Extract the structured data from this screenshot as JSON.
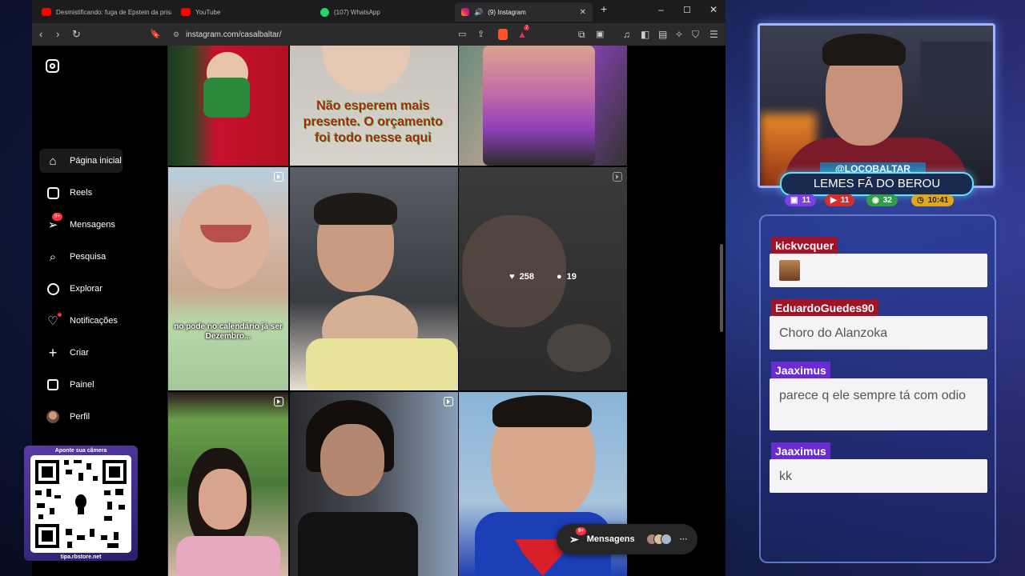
{
  "browser": {
    "tabs": [
      {
        "label": "Desmistificando: fuga de Epstein da prisão e"
      },
      {
        "label": "YouTube"
      },
      {
        "label": "(107) WhatsApp"
      },
      {
        "label": "(9) Instagram"
      }
    ],
    "url": "instagram.com/casalbaltar/",
    "extension_badge": "7"
  },
  "instagram": {
    "nav": [
      {
        "label": "Página inicial",
        "icon": "home-icon"
      },
      {
        "label": "Reels",
        "icon": "reels-icon"
      },
      {
        "label": "Mensagens",
        "icon": "messages-icon",
        "badge": "9+"
      },
      {
        "label": "Pesquisa",
        "icon": "search-icon"
      },
      {
        "label": "Explorar",
        "icon": "explore-icon"
      },
      {
        "label": "Notificações",
        "icon": "heart-icon"
      },
      {
        "label": "Criar",
        "icon": "plus-icon"
      },
      {
        "label": "Painel",
        "icon": "dashboard-icon"
      },
      {
        "label": "Perfil",
        "icon": "avatar"
      }
    ],
    "posts": {
      "post2_text": "Não esperem mais presente. O orçamento foi todo nesse aqui",
      "post4_text": "no pode no calendário já ser Dezembro...",
      "post6_likes": "258",
      "post6_comments": "19"
    },
    "messages_pill": {
      "label": "Mensagens",
      "badge": "9+"
    }
  },
  "qr_card": {
    "caption": "Aponte sua câmera",
    "footer": "tipa.rbstore.net"
  },
  "overlay": {
    "streamer_handle": "@LOCOBALTAR",
    "stream_title": "LEMES FÃ DO BEROU",
    "stats": [
      {
        "icon": "twitch-icon",
        "value": "11",
        "color": "#7b3fe4"
      },
      {
        "icon": "youtube-icon",
        "value": "11",
        "color": "#d23030"
      },
      {
        "icon": "kick-icon",
        "value": "32",
        "color": "#2f9d4a"
      },
      {
        "icon": "clock-icon",
        "value": "10:41",
        "color": "#e0a71a"
      }
    ],
    "chat": [
      {
        "user": "kickvcquer",
        "message": "",
        "emote": true,
        "user_color": "#a0142a"
      },
      {
        "user": "EduardoGuedes90",
        "message": "Choro do Alanzoka",
        "user_color": "#a0142a"
      },
      {
        "user": "Jaaximus",
        "message": "parece q ele sempre tá com odio",
        "user_color": "#6a2bd0"
      },
      {
        "user": "Jaaximus",
        "message": "kk",
        "user_color": "#6a2bd0"
      }
    ]
  }
}
